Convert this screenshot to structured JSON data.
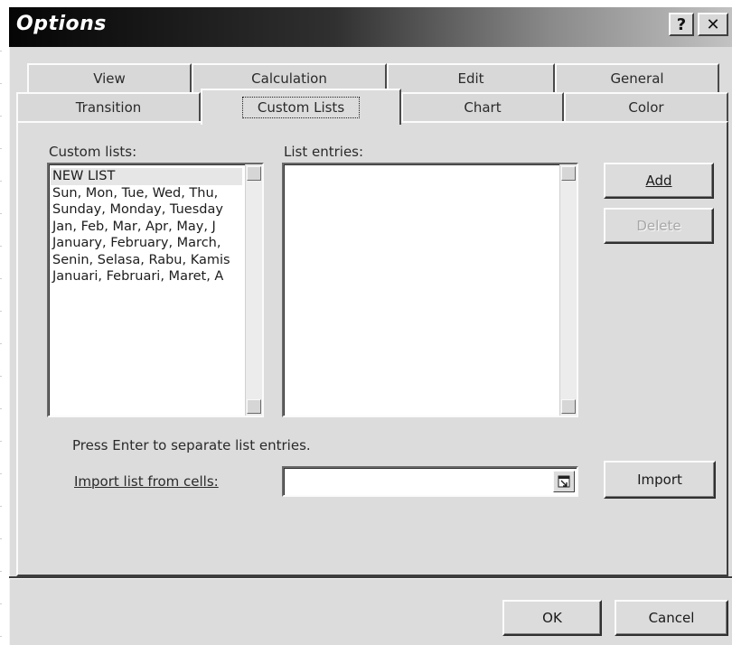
{
  "window": {
    "title": "Options",
    "help_label": "?",
    "close_label": "✕"
  },
  "tabs": {
    "row1": [
      "View",
      "Calculation",
      "Edit",
      "General"
    ],
    "row2": [
      "Transition",
      "Custom Lists",
      "Chart",
      "Color"
    ],
    "active": "Custom Lists"
  },
  "custom_lists": {
    "label": "Custom lists:",
    "items": [
      "NEW LIST",
      "Sun, Mon, Tue, Wed, Thu,",
      "Sunday, Monday, Tuesday",
      "Jan, Feb, Mar, Apr, May, J",
      "January, February, March,",
      "Senin, Selasa, Rabu, Kamis",
      "Januari, Februari, Maret, A"
    ],
    "selected_index": 0
  },
  "list_entries": {
    "label": "List entries:",
    "items": []
  },
  "buttons": {
    "add": "Add",
    "delete": "Delete",
    "import": "Import",
    "ok": "OK",
    "cancel": "Cancel"
  },
  "hint": "Press Enter to separate list entries.",
  "import_field": {
    "label": "Import list from cells:",
    "value": ""
  },
  "icons": {
    "collapse_dialog": "range-select-icon"
  }
}
